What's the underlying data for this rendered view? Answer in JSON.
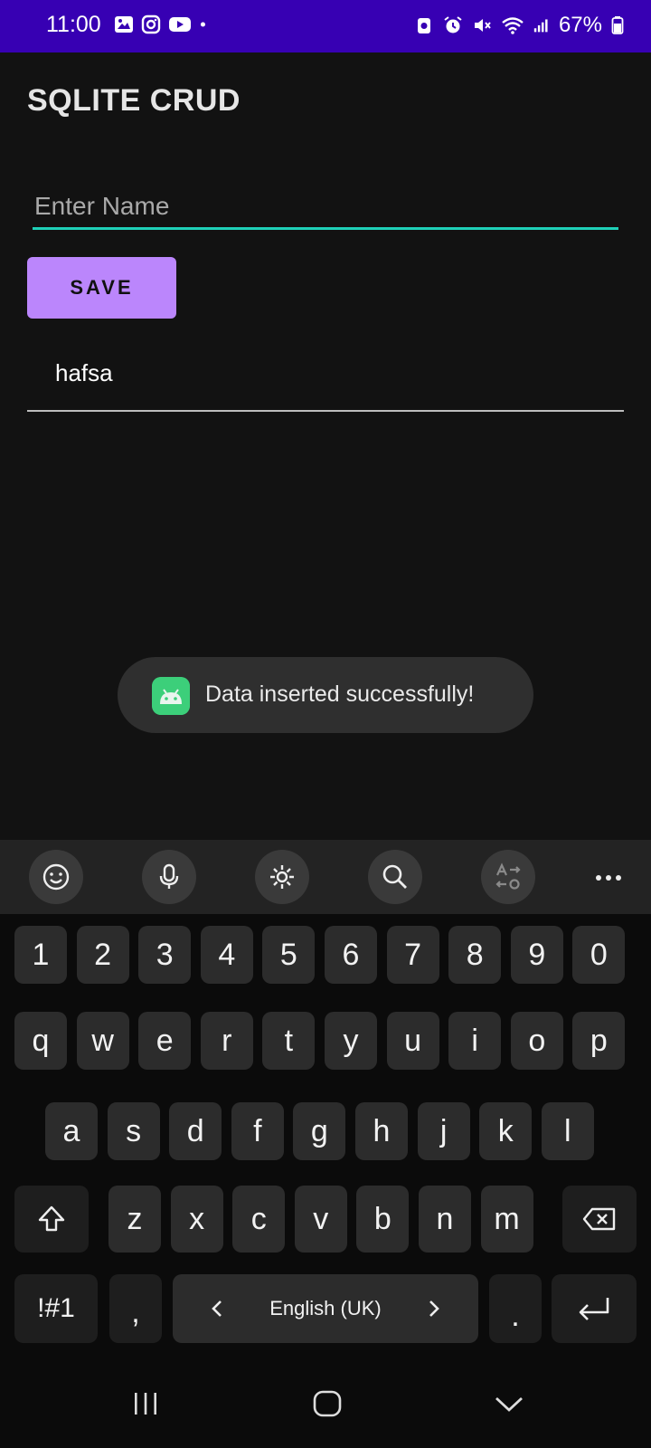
{
  "status_bar": {
    "time": "11:00",
    "battery": "67%",
    "color": "#3700b3",
    "left_icons": [
      "gallery-icon",
      "instagram-icon",
      "youtube-icon",
      "dot-icon"
    ],
    "right_icons": [
      "battery-saver-icon",
      "alarm-icon",
      "mute-icon",
      "wifi-icon",
      "signal-icon",
      "battery-icon"
    ]
  },
  "app": {
    "title": "SQLITE CRUD",
    "accent": "#1fd0b8",
    "button_color": "#bb86fc"
  },
  "form": {
    "name_placeholder": "Enter Name",
    "name_value": "",
    "save_label": "SAVE"
  },
  "list": {
    "items": [
      "hafsa"
    ]
  },
  "toast": {
    "message": "Data inserted successfully!",
    "icon": "android-icon"
  },
  "keyboard": {
    "toolbar": [
      "emoji-icon",
      "microphone-icon",
      "settings-icon",
      "search-icon",
      "translate-icon",
      "more-icon"
    ],
    "row_numbers": [
      "1",
      "2",
      "3",
      "4",
      "5",
      "6",
      "7",
      "8",
      "9",
      "0"
    ],
    "row_1": [
      "q",
      "w",
      "e",
      "r",
      "t",
      "y",
      "u",
      "i",
      "o",
      "p"
    ],
    "row_2": [
      "a",
      "s",
      "d",
      "f",
      "g",
      "h",
      "j",
      "k",
      "l"
    ],
    "row_3": [
      "z",
      "x",
      "c",
      "v",
      "b",
      "n",
      "m"
    ],
    "symbols_label": "!#1",
    "comma": ",",
    "period": ".",
    "space_label": "English (UK)"
  },
  "nav": [
    "recent-apps-icon",
    "home-icon",
    "back-icon"
  ]
}
